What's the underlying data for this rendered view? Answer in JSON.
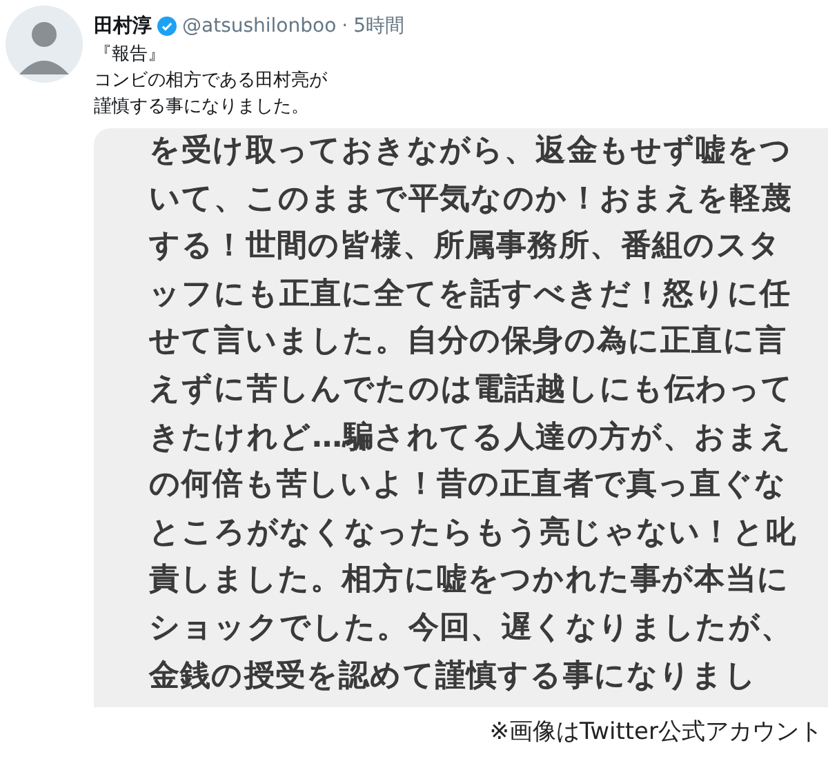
{
  "tweet": {
    "author": {
      "name": "田村淳",
      "verified": true,
      "handle": "@atsushilonboo",
      "separator": "·",
      "time": "5時間"
    },
    "text_lines": [
      "『報告』",
      "コンビの相方である田村亮が",
      "謹慎する事になりました。"
    ],
    "image_lines": [
      "を受け取っておきながら、返金もせず嘘をつ",
      "いて、このままで平気なのか！おまえを軽蔑",
      "する！世間の皆様、所属事務所、番組のスタ",
      "ッフにも正直に全てを話すべきだ！怒りに任",
      "せて言いました。自分の保身の為に正直に言",
      "えずに苦しんでたのは電話越しにも伝わって",
      "きたけれど…騙されてる人達の方が、おまえ",
      "の何倍も苦しいよ！昔の正直者で真っ直ぐな",
      "ところがなくなったらもう亮じゃない！と叱",
      "責しました。相方に嘘をつかれた事が本当に",
      "ショックでした。今回、遅くなりましたが、",
      "金銭の授受を認めて謹慎する事になりまし"
    ]
  },
  "caption": "※画像はTwitter公式アカウント"
}
